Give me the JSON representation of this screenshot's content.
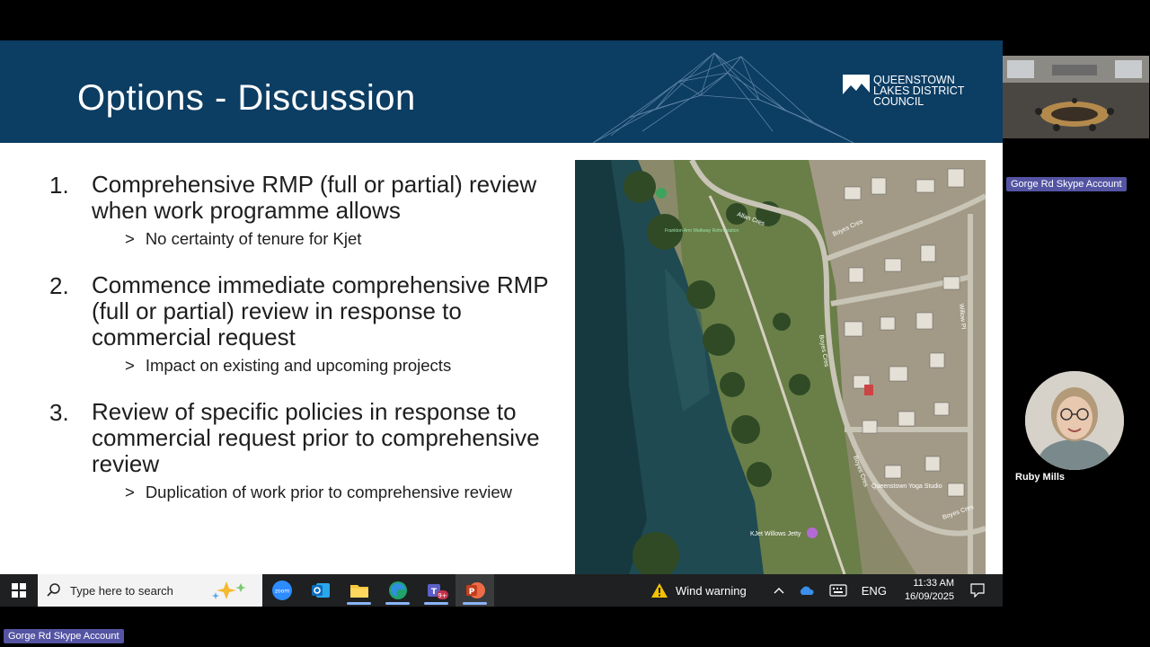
{
  "slide": {
    "title": "Options - Discussion",
    "logo": {
      "line1": "QUEENSTOWN",
      "line2": "LAKES DISTRICT",
      "line3": "COUNCIL"
    },
    "options": [
      {
        "number": "1.",
        "text": "Comprehensive RMP (full or partial) review when work programme allows",
        "sub": "No certainty of tenure for Kjet"
      },
      {
        "number": "2.",
        "text": "Commence immediate comprehensive RMP (full or partial) review in response to commercial request",
        "sub": "Impact on existing and upcoming projects"
      },
      {
        "number": "3.",
        "text": "Review of specific policies in response to commercial request prior to comprehensive review",
        "sub": "Duplication of work prior to comprehensive review"
      }
    ],
    "sub_marker": ">",
    "map_labels": {
      "allan_cres": "Allan Cres",
      "boyes_cres_1": "Boyes Cres",
      "boyes_cres_2": "Boyes Cres",
      "boyes_cres_3": "Boyes Cres",
      "boyes_cres_4": "Boyes Cres",
      "willow_pl": "Willow Pl",
      "reserve": "Frankton Arm Walkway Reforestation",
      "yoga": "Queenstown Yoga Studio",
      "jetty": "KJet Willows Jetty"
    }
  },
  "video": {
    "room_tag": "Gorge Rd Skype Account",
    "participant": "Ruby Mills",
    "bottom_tag": "Gorge Rd Skype Account"
  },
  "taskbar": {
    "search_placeholder": "Type here to search",
    "apps": [
      "zoom-icon",
      "outlook-icon",
      "file-explorer-icon",
      "edge-icon",
      "teams-icon",
      "powerpoint-icon"
    ],
    "teams_badge": "9+",
    "zoom_label": "zoom",
    "weather": "Wind warning",
    "language": "ENG",
    "time": "11:33 AM",
    "date": "16/09/2025"
  },
  "colors": {
    "header": "#0c3d63",
    "tag": "#5454a3",
    "taskbar": "#1f2021"
  }
}
